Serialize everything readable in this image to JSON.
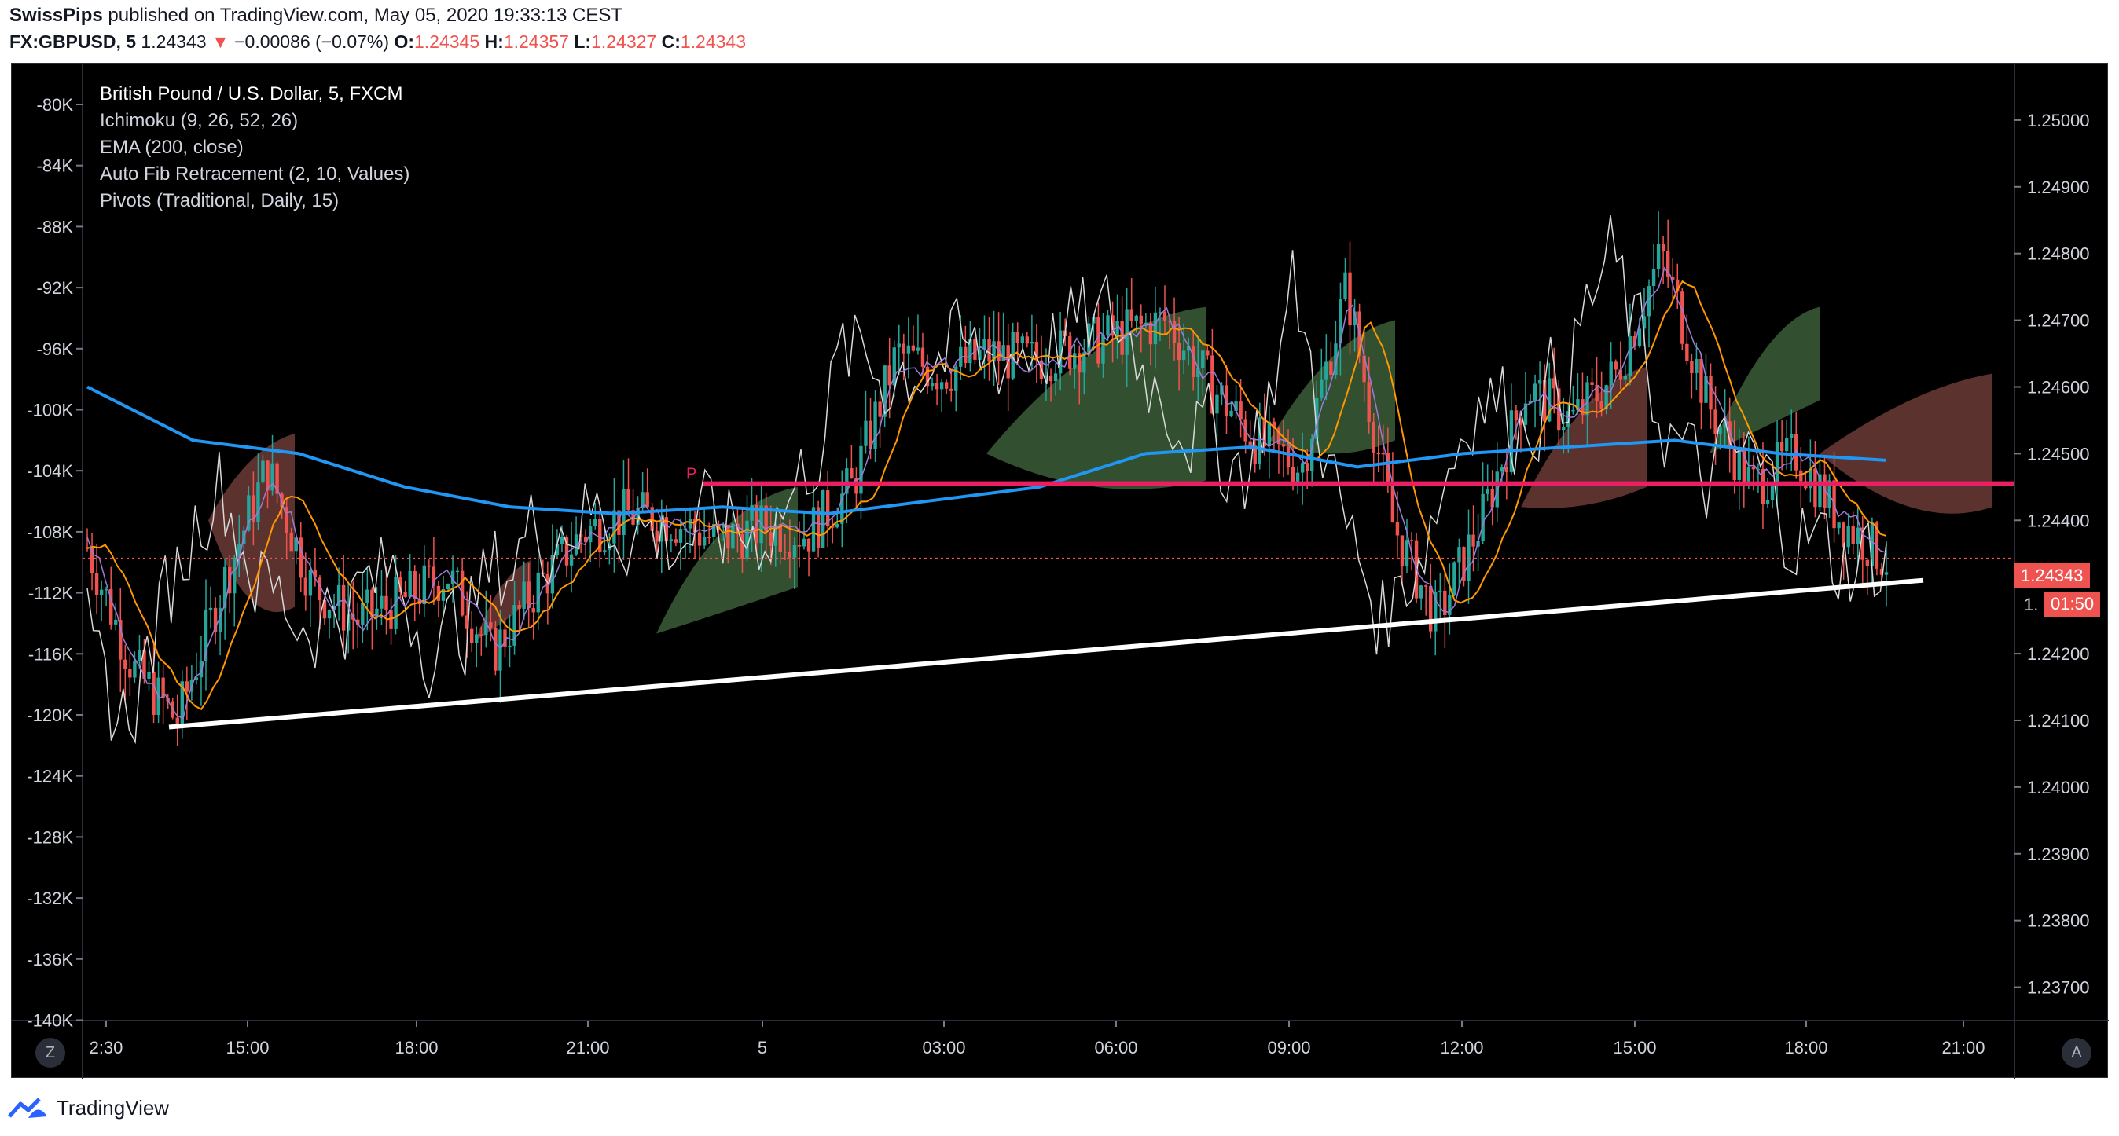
{
  "header": {
    "publisher": "SwissPips",
    "published_text": "published on TradingView.com, May 05, 2020 19:33:13 CEST",
    "symbol": "FX:GBPUSD, 5",
    "last": "1.24343",
    "change_arrow": "▼",
    "change": "−0.00086 (−0.07%)",
    "o_label": "O:",
    "o": "1.24345",
    "h_label": "H:",
    "h": "1.24357",
    "l_label": "L:",
    "l": "1.24327",
    "c_label": "C:",
    "c": "1.24343"
  },
  "legend": {
    "title": "British Pound / U.S. Dollar, 5, FXCM",
    "items": [
      "Ichimoku (9, 26, 52, 26)",
      "EMA (200, close)",
      "Auto Fib Retracement (2, 10, Values)",
      "Pivots (Traditional, Daily, 15)"
    ]
  },
  "left_axis": [
    "-80K",
    "-84K",
    "-88K",
    "-92K",
    "-96K",
    "-100K",
    "-104K",
    "-108K",
    "-112K",
    "-116K",
    "-120K",
    "-124K",
    "-128K",
    "-132K",
    "-136K",
    "-140K"
  ],
  "right_axis": [
    "1.25000",
    "1.24900",
    "1.24800",
    "1.24700",
    "1.24600",
    "1.24500",
    "1.24400",
    "1.24300",
    "1.24200",
    "1.24100",
    "1.24000",
    "1.23900",
    "1.23800",
    "1.23700"
  ],
  "time_axis": [
    "2:30",
    "15:00",
    "18:00",
    "21:00",
    "5",
    "03:00",
    "06:00",
    "09:00",
    "12:00",
    "15:00",
    "18:00",
    "21:00"
  ],
  "pivot_label": "P",
  "current_price_tag": "1.24343",
  "countdown_tag": "01:50",
  "countdown_prefix": "1.",
  "buttons": {
    "left": "Z",
    "right": "A"
  },
  "footer": {
    "brand": "TradingView"
  },
  "colors": {
    "up": "#26a69a",
    "down": "#ef5350",
    "ema": "#2196f3",
    "pivot": "#e91e63",
    "cloud_bull": "#3b5e37",
    "cloud_bear": "#6b3b36",
    "trendline": "#ffffff"
  },
  "chart_data": {
    "type": "candlestick",
    "symbol": "GBPUSD",
    "timeframe": "5",
    "right_axis_range": [
      1.2365,
      1.2508
    ],
    "pivot_level": 1.24455,
    "current_price": 1.24343,
    "trendline": {
      "from": [
        "2:30",
        1.2409
      ],
      "to": [
        "21:00",
        1.243
      ]
    },
    "ema_200": [
      1.246,
      1.2452,
      1.245,
      1.2445,
      1.2442,
      1.2441,
      1.2442,
      1.2441,
      1.2443,
      1.2445,
      1.245,
      1.2451,
      1.2448,
      1.245,
      1.2451,
      1.2452,
      1.245,
      1.2449
    ],
    "price_path": [
      1.2436,
      1.2418,
      1.241,
      1.243,
      1.2448,
      1.243,
      1.2425,
      1.2428,
      1.2432,
      1.242,
      1.243,
      1.2438,
      1.2441,
      1.244,
      1.2437,
      1.2439,
      1.2438,
      1.2445,
      1.2465,
      1.2462,
      1.2465,
      1.2464,
      1.2466,
      1.2468,
      1.247,
      1.246,
      1.2452,
      1.2448,
      1.2475,
      1.244,
      1.2425,
      1.244,
      1.246,
      1.2455,
      1.2462,
      1.248,
      1.2458,
      1.2445,
      1.245,
      1.244,
      1.2434
    ]
  }
}
